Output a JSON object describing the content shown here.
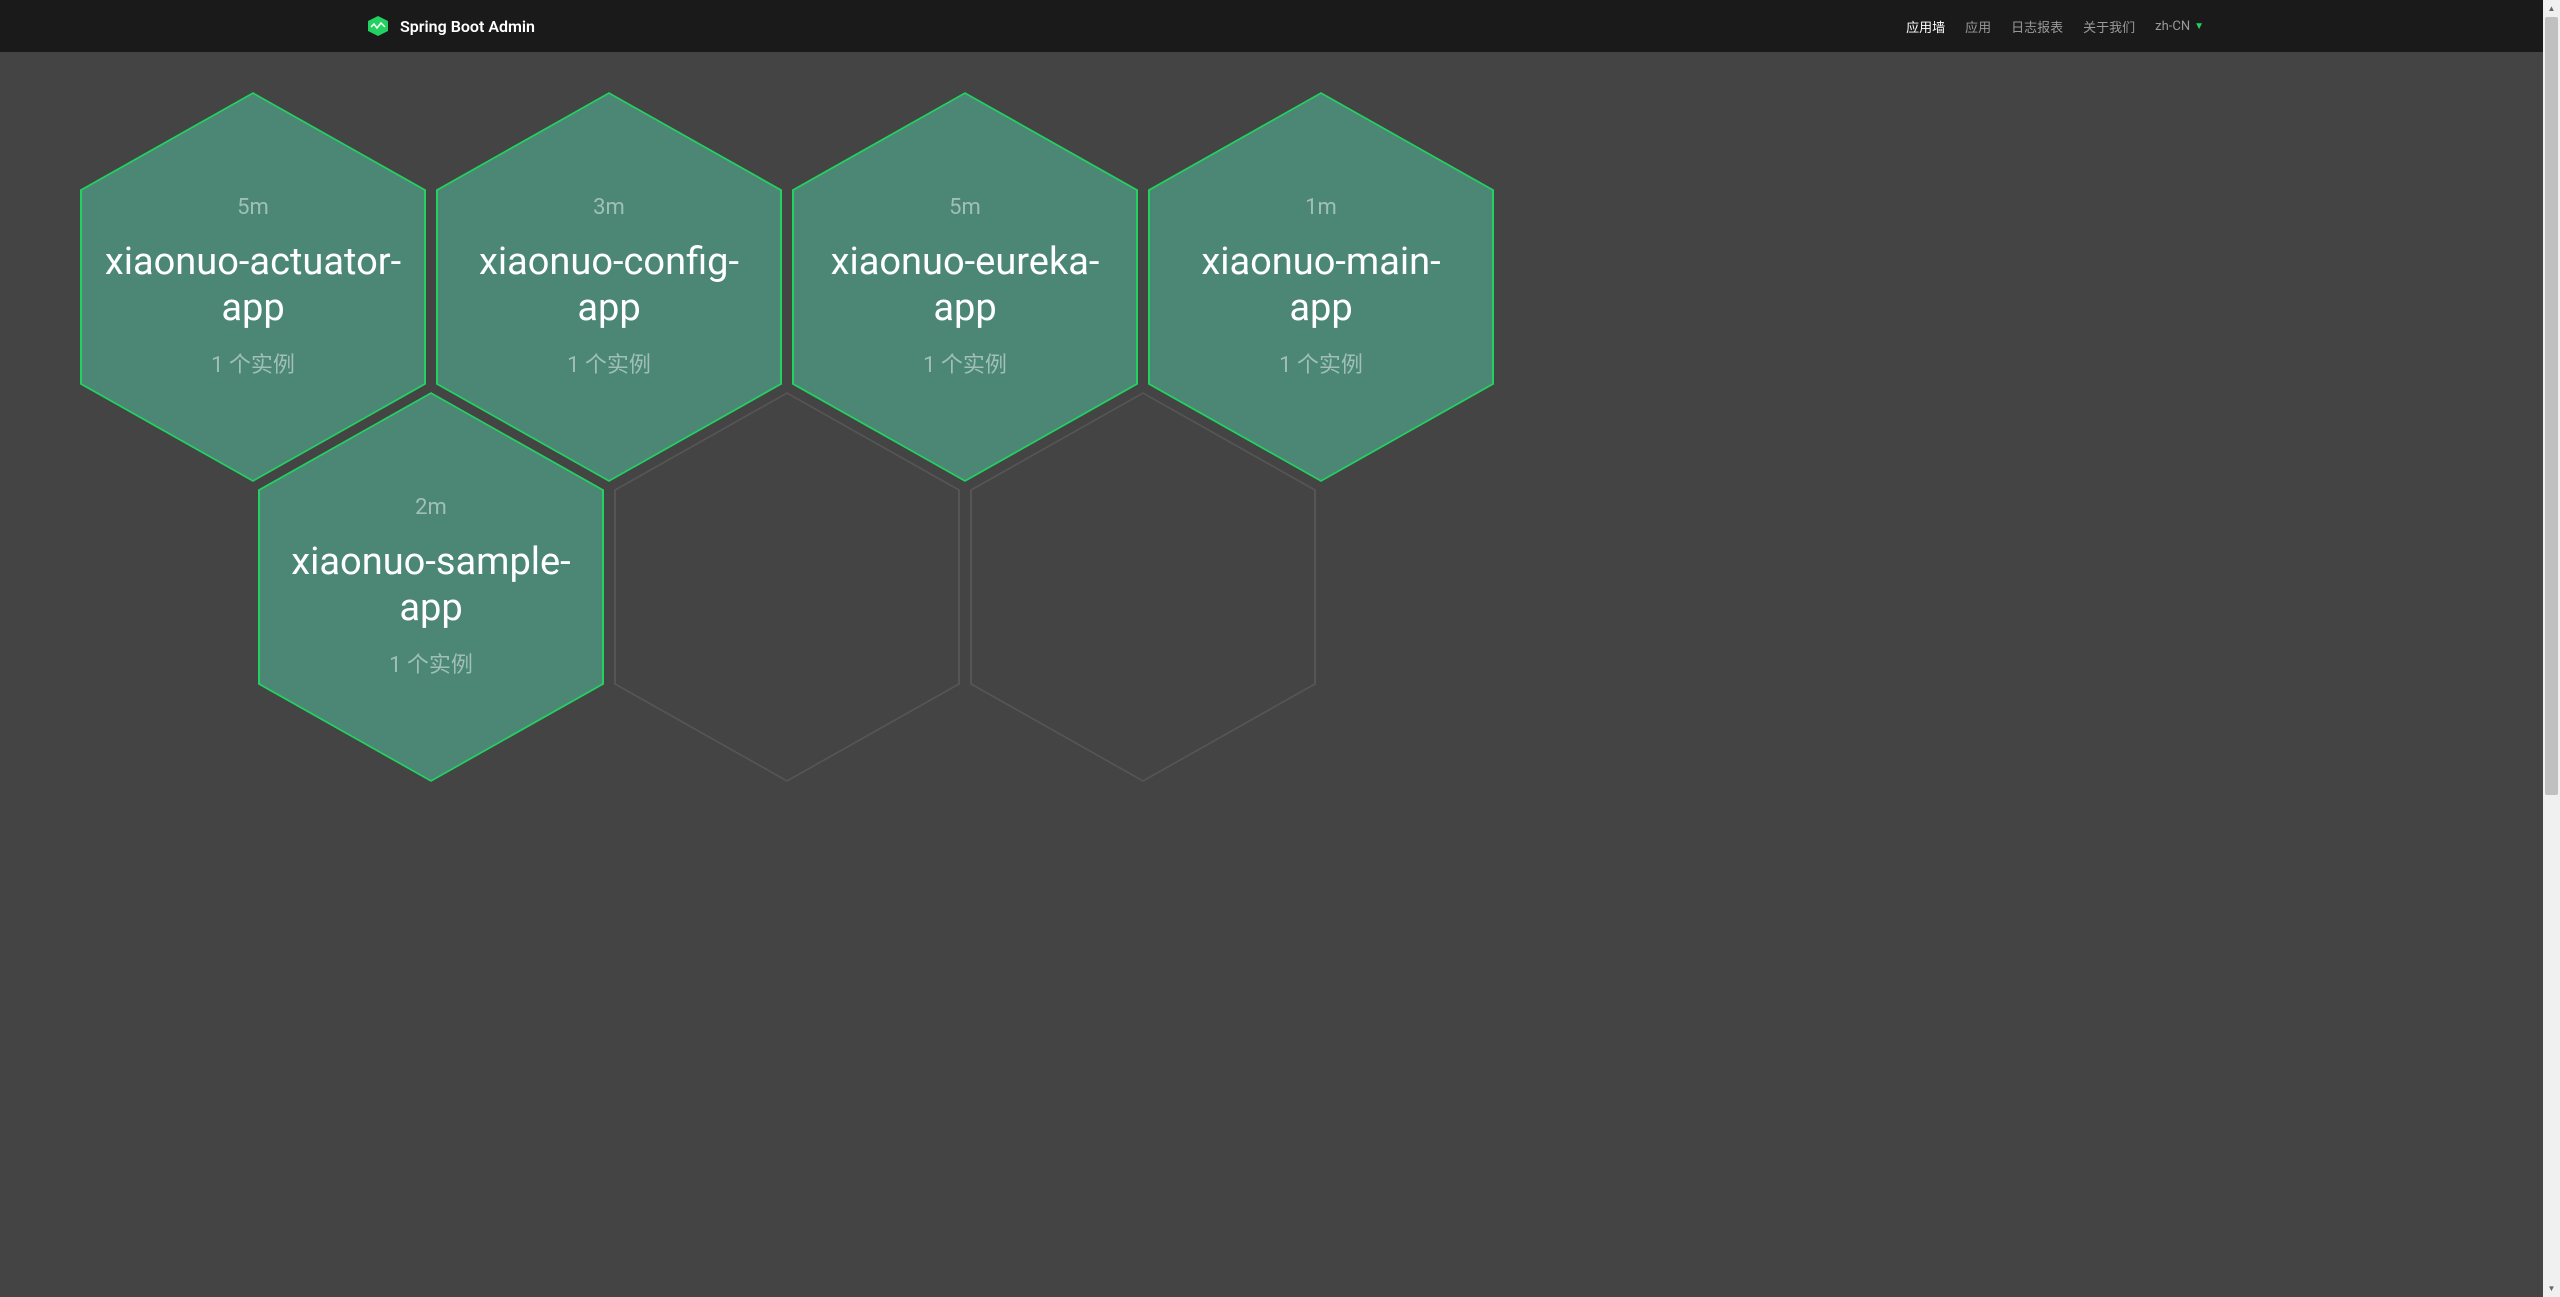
{
  "brand": {
    "title": "Spring Boot Admin"
  },
  "nav": {
    "items": [
      {
        "label": "应用墙",
        "active": true
      },
      {
        "label": "应用",
        "active": false
      },
      {
        "label": "日志报表",
        "active": false
      },
      {
        "label": "关于我们",
        "active": false
      }
    ],
    "language": "zh-CN"
  },
  "apps": [
    {
      "time": "5m",
      "name": "xiaonuo-actuator-app",
      "instances": "1 个实例",
      "status": "up"
    },
    {
      "time": "3m",
      "name": "xiaonuo-config-app",
      "instances": "1 个实例",
      "status": "up"
    },
    {
      "time": "5m",
      "name": "xiaonuo-eureka-app",
      "instances": "1 个实例",
      "status": "up"
    },
    {
      "time": "1m",
      "name": "xiaonuo-main-app",
      "instances": "1 个实例",
      "status": "up"
    },
    {
      "time": "2m",
      "name": "xiaonuo-sample-app",
      "instances": "1 个实例",
      "status": "up"
    }
  ],
  "colors": {
    "accent": "#23d160",
    "hexFill": "#4c8776",
    "background": "#444444",
    "navbar": "#1a1a1a"
  }
}
